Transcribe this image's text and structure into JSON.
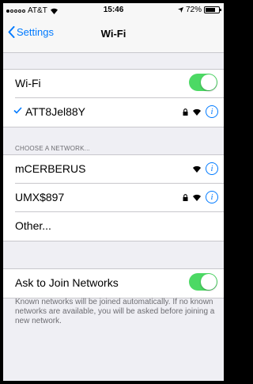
{
  "status_bar": {
    "carrier": "AT&T",
    "time": "15:46",
    "battery": "72%",
    "battery_level": 0.72
  },
  "nav": {
    "back_label": "Settings",
    "title": "Wi-Fi"
  },
  "wifi_row": {
    "label": "Wi-Fi",
    "toggle_on": true
  },
  "connected_network": {
    "name": "ATT8Jel88Y",
    "locked": true
  },
  "networks_header": "CHOOSE A NETWORK...",
  "networks": [
    {
      "name": "mCERBERUS",
      "locked": false
    },
    {
      "name": "UMX$897",
      "locked": true
    }
  ],
  "other_label": "Other...",
  "ask_join": {
    "label": "Ask to Join Networks",
    "toggle_on": true
  },
  "footer_text": "Known networks will be joined automatically. If no known networks are available, you will be asked before joining a new network.",
  "colors": {
    "accent": "#007aff",
    "toggle_on": "#4cd964",
    "background": "#efeff4"
  },
  "icons": [
    "checkmark-icon",
    "lock-icon",
    "wifi-icon",
    "info-icon",
    "back-chevron-icon"
  ]
}
